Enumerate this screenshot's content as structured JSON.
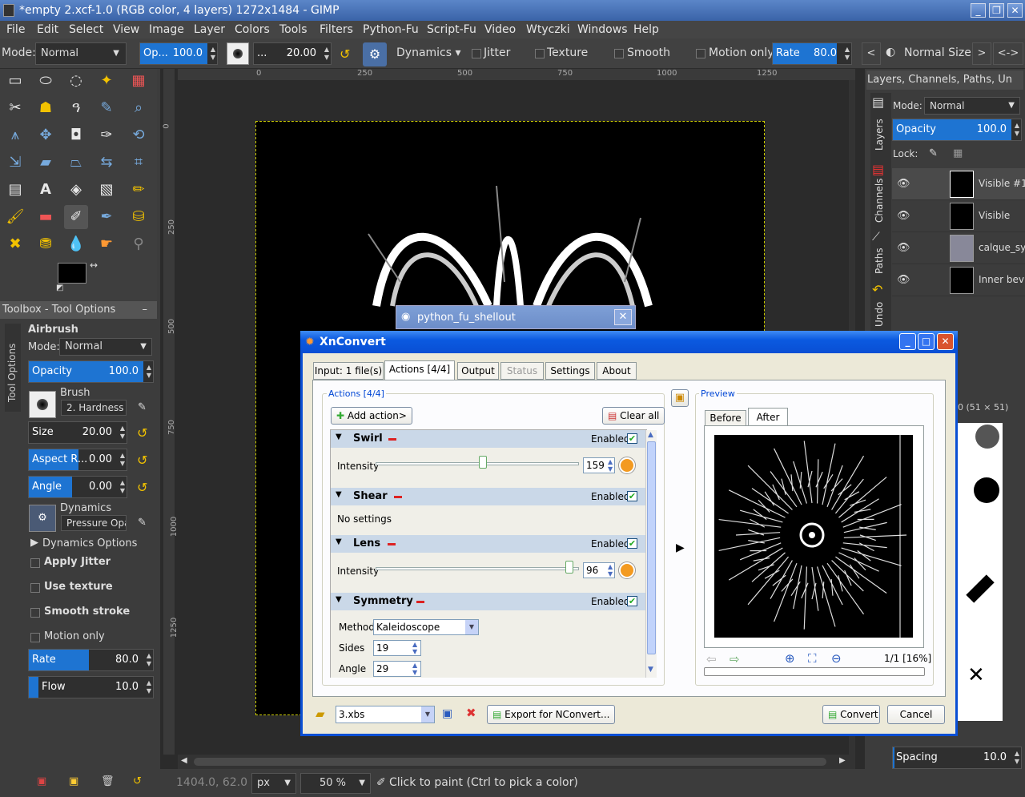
{
  "gimp": {
    "title": "*empty 2.xcf-1.0 (RGB color, 4 layers) 1272x1484 - GIMP",
    "menu": [
      "File",
      "Edit",
      "Select",
      "View",
      "Image",
      "Layer",
      "Colors",
      "Tools",
      "Filters",
      "Python-Fu",
      "Script-Fu",
      "Video",
      "Wtyczki",
      "Windows",
      "Help"
    ],
    "options": {
      "mode_label": "Mode:",
      "mode_value": "Normal",
      "opacity_label": "Op...",
      "opacity_value": "100.0",
      "size_label": "...",
      "size_value": "20.00",
      "dynamics": "Dynamics",
      "jitter": "Jitter",
      "texture": "Texture",
      "smooth": "Smooth",
      "motion_only": "Motion only",
      "rate_label": "Rate",
      "rate_value": "80.0",
      "prev": "<",
      "normal_size": "Normal Size",
      "next": ">",
      "toggle": "<->"
    },
    "toolbox_header": "Toolbox - Tool Options",
    "tool_options": {
      "side_tab": "Tool Options",
      "title": "Airbrush",
      "mode_label": "Mode:",
      "mode_value": "Normal",
      "opacity_label": "Opacity",
      "opacity_value": "100.0",
      "brush_label": "Brush",
      "brush_value": "2. Hardness 0",
      "size_label": "Size",
      "size_value": "20.00",
      "aspect_label": "Aspect R...",
      "aspect_value": "0.00",
      "angle_label": "Angle",
      "angle_value": "0.00",
      "dynamics_label": "Dynamics",
      "dynamics_value": "Pressure Opa",
      "dynamics_options": "Dynamics Options",
      "apply_jitter": "Apply Jitter",
      "use_texture": "Use texture",
      "smooth_stroke": "Smooth stroke",
      "motion_only": "Motion only",
      "rate_label": "Rate",
      "rate_value": "80.0",
      "flow_label": "Flow",
      "flow_value": "10.0"
    },
    "ruler_h": [
      "0",
      "250",
      "500",
      "750",
      "1000",
      "1250"
    ],
    "ruler_v": [
      "0",
      "250",
      "500",
      "750",
      "1000",
      "1250"
    ],
    "status": {
      "coords": "1404.0, 62.0",
      "unit": "px",
      "zoom": "50 %",
      "message": "Click to paint (Ctrl to pick a color)"
    },
    "dock": {
      "header": "Layers, Channels, Paths, Un",
      "tabs": [
        "Layers",
        "Channels",
        "Paths",
        "Undo"
      ],
      "mode_label": "Mode:",
      "mode_value": "Normal",
      "opacity_label": "Opacity",
      "opacity_value": "100.0",
      "lock_label": "Lock:",
      "layers": [
        "Visible #1",
        "Visible",
        "calque_sy",
        "Inner bev"
      ],
      "brush_size": "0 (51 × 51)",
      "spacing_label": "Spacing",
      "spacing_value": "10.0"
    },
    "python_dialog": "python_fu_shellout"
  },
  "xnconvert": {
    "title": "XnConvert",
    "tabs": [
      "Input: 1 file(s)",
      "Actions [4/4]",
      "Output",
      "Status",
      "Settings",
      "About"
    ],
    "actions_group": "Actions [4/4]",
    "add_action": "Add action>",
    "clear_all": "Clear all",
    "enabled": "Enabled",
    "actions": [
      {
        "name": "Swirl",
        "param": "Intensity",
        "value": "159",
        "fraction": 0.53
      },
      {
        "name": "Shear",
        "note": "No settings"
      },
      {
        "name": "Lens",
        "param": "Intensity",
        "value": "96",
        "fraction": 0.97
      },
      {
        "name": "Symmetry",
        "method_label": "Method",
        "method_value": "Kaleidoscope",
        "sides_label": "Sides",
        "sides_value": "19",
        "angle_label": "Angle",
        "angle_value": "29"
      }
    ],
    "preview_group": "Preview",
    "preview_tabs": [
      "Before",
      "After"
    ],
    "preview_info": "1/1 [16%]",
    "preset": "3.xbs",
    "export_button": "Export for NConvert...",
    "convert_button": "Convert",
    "cancel_button": "Cancel"
  }
}
